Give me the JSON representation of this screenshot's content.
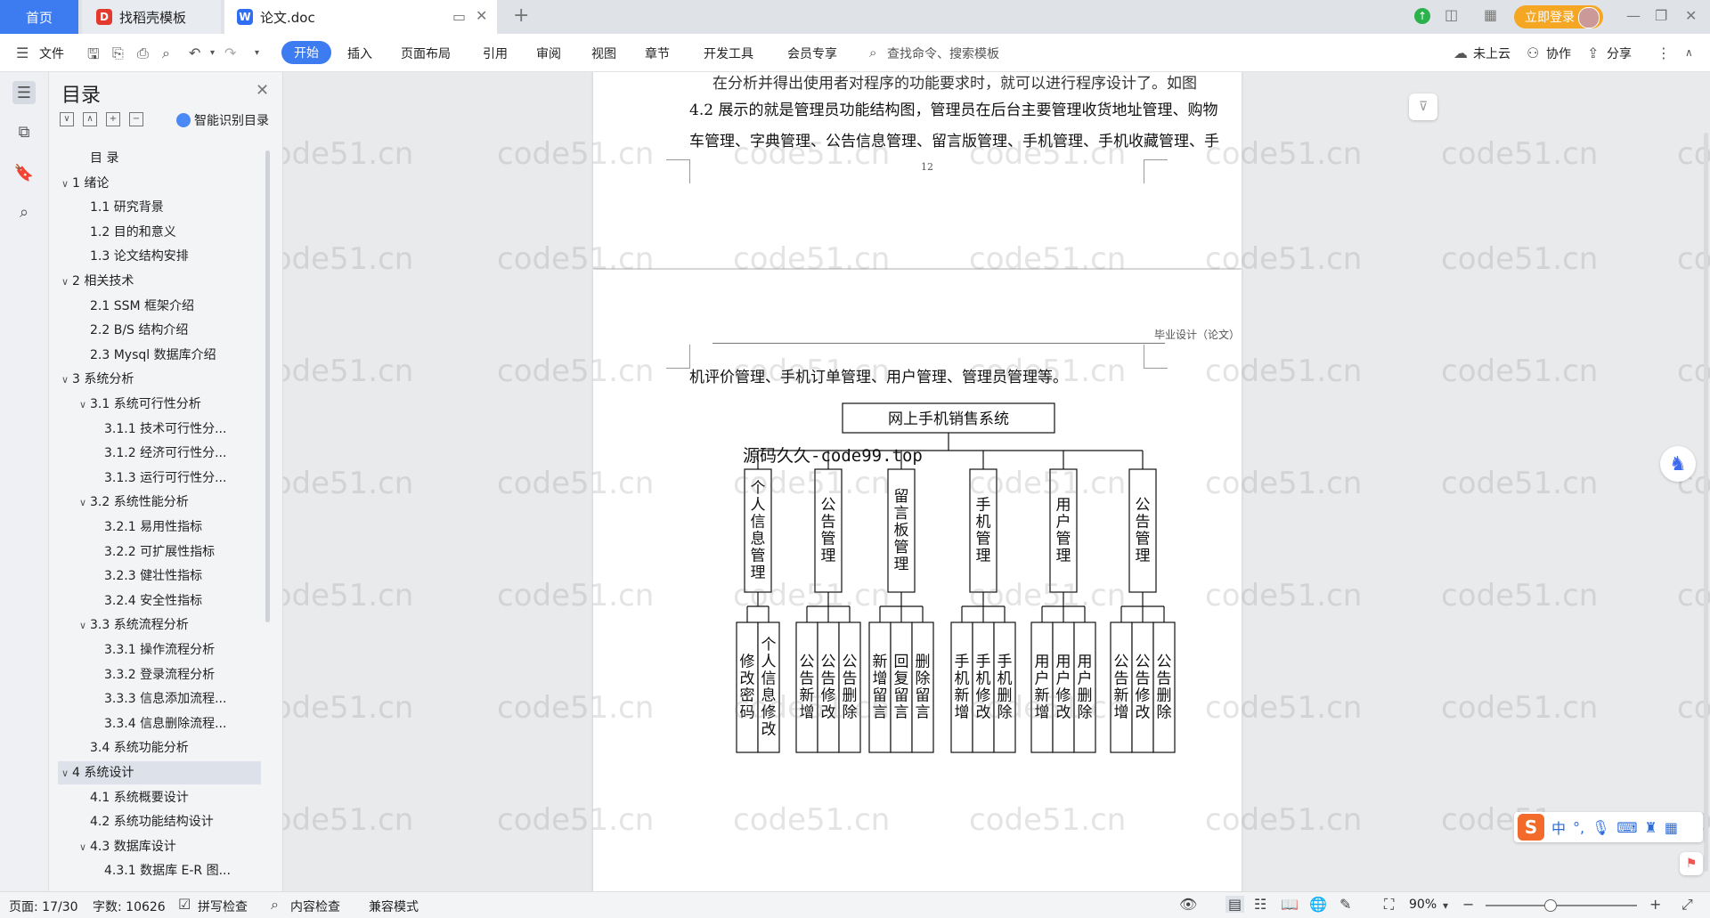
{
  "tabs": {
    "home": "首页",
    "template": "找稻壳模板",
    "doc": "论文.doc",
    "login": "立即登录"
  },
  "menu": {
    "file": "文件",
    "start": "开始",
    "insert": "插入",
    "layout": "页面布局",
    "reference": "引用",
    "review": "审阅",
    "view": "视图",
    "chapter": "章节",
    "devtools": "开发工具",
    "vip": "会员专享",
    "search_placeholder": "查找命令、搜索模板",
    "cloud": "未上云",
    "collab": "协作",
    "share": "分享"
  },
  "toc": {
    "title": "目录",
    "ai": "智能识别目录",
    "items": [
      {
        "label": "目 录",
        "level": 1,
        "chev": ""
      },
      {
        "label": "1 绪论",
        "level": 0,
        "chev": "∨"
      },
      {
        "label": "1.1 研究背景",
        "level": 1,
        "chev": ""
      },
      {
        "label": "1.2 目的和意义",
        "level": 1,
        "chev": ""
      },
      {
        "label": "1.3 论文结构安排",
        "level": 1,
        "chev": ""
      },
      {
        "label": "2 相关技术",
        "level": 0,
        "chev": "∨"
      },
      {
        "label": "2.1 SSM 框架介绍",
        "level": 1,
        "chev": ""
      },
      {
        "label": "2.2 B/S 结构介绍",
        "level": 1,
        "chev": ""
      },
      {
        "label": "2.3 Mysql 数据库介绍",
        "level": 1,
        "chev": ""
      },
      {
        "label": "3 系统分析",
        "level": 0,
        "chev": "∨"
      },
      {
        "label": "3.1 系统可行性分析",
        "level": 1,
        "chev": "∨"
      },
      {
        "label": "3.1.1 技术可行性分...",
        "level": 2,
        "chev": ""
      },
      {
        "label": "3.1.2 经济可行性分...",
        "level": 2,
        "chev": ""
      },
      {
        "label": "3.1.3 运行可行性分...",
        "level": 2,
        "chev": ""
      },
      {
        "label": "3.2 系统性能分析",
        "level": 1,
        "chev": "∨"
      },
      {
        "label": "3.2.1 易用性指标",
        "level": 2,
        "chev": ""
      },
      {
        "label": "3.2.2 可扩展性指标",
        "level": 2,
        "chev": ""
      },
      {
        "label": "3.2.3 健壮性指标",
        "level": 2,
        "chev": ""
      },
      {
        "label": "3.2.4 安全性指标",
        "level": 2,
        "chev": ""
      },
      {
        "label": "3.3 系统流程分析",
        "level": 1,
        "chev": "∨"
      },
      {
        "label": "3.3.1 操作流程分析",
        "level": 2,
        "chev": ""
      },
      {
        "label": "3.3.2 登录流程分析",
        "level": 2,
        "chev": ""
      },
      {
        "label": "3.3.3 信息添加流程...",
        "level": 2,
        "chev": ""
      },
      {
        "label": "3.3.4 信息删除流程...",
        "level": 2,
        "chev": ""
      },
      {
        "label": "3.4 系统功能分析",
        "level": 1,
        "chev": ""
      },
      {
        "label": "4 系统设计",
        "level": 0,
        "chev": "∨",
        "selected": true
      },
      {
        "label": "4.1 系统概要设计",
        "level": 1,
        "chev": ""
      },
      {
        "label": "4.2 系统功能结构设计",
        "level": 1,
        "chev": ""
      },
      {
        "label": "4.3 数据库设计",
        "level": 1,
        "chev": "∨"
      },
      {
        "label": "4.3.1 数据库 E-R 图...",
        "level": 2,
        "chev": ""
      }
    ]
  },
  "doc": {
    "p1_line0": "在分析并得出使用者对程序的功能要求时，就可以进行程序设计了。如图",
    "p1_line1": "4.2 展示的就是管理员功能结构图，管理员在后台主要管理收货地址管理、购物",
    "p1_line2": "车管理、字典管理、公告信息管理、留言版管理、手机管理、手机收藏管理、手",
    "page_number": "12",
    "header_label": "毕业设计（论文）",
    "p2_line0": "机评价管理、手机订单管理、用户管理、管理员管理等。",
    "stamp": "源码久久-code99.top",
    "watermark": "code51.cn"
  },
  "diagram": {
    "root": "网上手机销售系统",
    "modules": [
      {
        "name": "个人信息管理",
        "children": [
          "修改密码",
          "个人信息修改"
        ]
      },
      {
        "name": "公告管理",
        "children": [
          "公告新增",
          "公告修改",
          "公告删除"
        ]
      },
      {
        "name": "留言板管理",
        "children": [
          "新增留言",
          "回复留言",
          "删除留言"
        ]
      },
      {
        "name": "手机管理",
        "children": [
          "手机新增",
          "手机修改",
          "手机删除"
        ]
      },
      {
        "name": "用户管理",
        "children": [
          "用户新增",
          "用户修改",
          "用户删除"
        ]
      },
      {
        "name": "公告管理",
        "children": [
          "公告新增",
          "公告修改",
          "公告删除"
        ]
      }
    ]
  },
  "status": {
    "page": "页面: 17/30",
    "words": "字数: 10626",
    "spell": "拼写检查",
    "content_check": "内容检查",
    "compat": "兼容模式",
    "zoom": "90%"
  },
  "ime": {
    "lang": "中",
    "punct": "°,"
  }
}
